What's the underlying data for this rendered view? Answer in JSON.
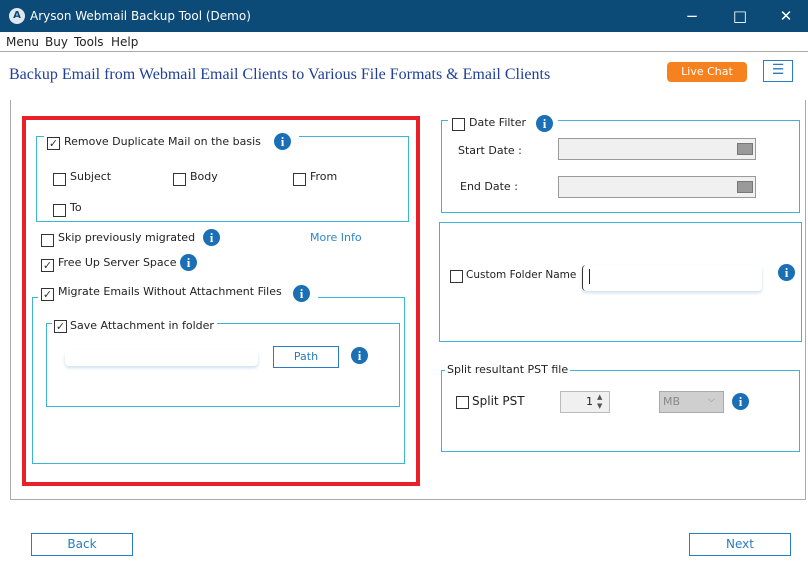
{
  "window": {
    "title": "Aryson Webmail Backup Tool (Demo)",
    "minimize": "−",
    "maximize": "□",
    "close": "✕"
  },
  "menu": [
    "Menu",
    "Buy",
    "Tools",
    "Help"
  ],
  "heading": "Backup Email from Webmail Email Clients to Various File Formats & Email Clients",
  "live_chat": "Live Chat",
  "menu_button": "☰",
  "left": {
    "remove_duplicate": {
      "label": "Remove Duplicate Mail on the basis",
      "checked": true
    },
    "dup_options": [
      {
        "label": "Subject",
        "checked": false
      },
      {
        "label": "Body",
        "checked": false
      },
      {
        "label": "From",
        "checked": false
      },
      {
        "label": "To",
        "checked": false
      }
    ],
    "skip": {
      "label": "Skip previously migrated",
      "checked": false
    },
    "more_info": "More Info",
    "free_up": {
      "label": "Free Up Server Space",
      "checked": true
    },
    "migrate_without": {
      "label": "Migrate Emails Without Attachment Files",
      "checked": true
    },
    "save_attachment": {
      "label": "Save Attachment in folder",
      "checked": true
    },
    "path_value": "",
    "path_button": "Path"
  },
  "right": {
    "date_filter": {
      "label": "Date Filter",
      "checked": false
    },
    "start_date": "Start Date :",
    "end_date": "End Date :",
    "custom_folder": {
      "label": "Custom Folder Name",
      "checked": false,
      "value": ""
    },
    "split_group": "Split resultant PST file",
    "split_pst": {
      "label": "Split PST",
      "checked": false
    },
    "split_size": "1",
    "split_unit": "MB"
  },
  "footer": {
    "back": "Back",
    "next": "Next"
  },
  "colors": {
    "titlebar": "#0c4a77",
    "accent": "#2a7bbf",
    "highlight": "#e8202a",
    "live_chat": "#f5821f",
    "group_border": "#3bb4d6"
  }
}
